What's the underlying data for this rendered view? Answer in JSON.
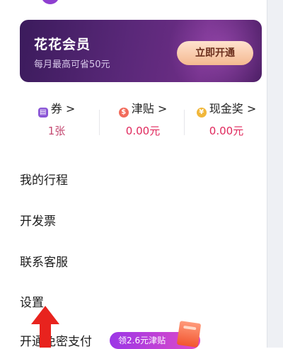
{
  "banner": {
    "title": "花花会员",
    "subtitle": "每月最高可省50元",
    "button_label": "立即开通"
  },
  "stats": [
    {
      "icon": "coupon-icon",
      "label": "券",
      "chevron": ">",
      "value": "1张"
    },
    {
      "icon": "allowance-icon",
      "label": "津贴",
      "chevron": ">",
      "value": "0.00元"
    },
    {
      "icon": "cash-reward-icon",
      "label": "现金奖",
      "chevron": ">",
      "value": "0.00元"
    }
  ],
  "menu": [
    {
      "label": "我的行程"
    },
    {
      "label": "开发票"
    },
    {
      "label": "联系客服"
    },
    {
      "label": "设置"
    },
    {
      "label": "开通免密支付"
    }
  ],
  "promo": {
    "label": "领2.6元津贴"
  },
  "colors": {
    "banner_bg": "#4a1f6a",
    "button_bg": "#f6c4a2",
    "value_red": "#e0285c",
    "promo_purple": "#9b37e6"
  }
}
